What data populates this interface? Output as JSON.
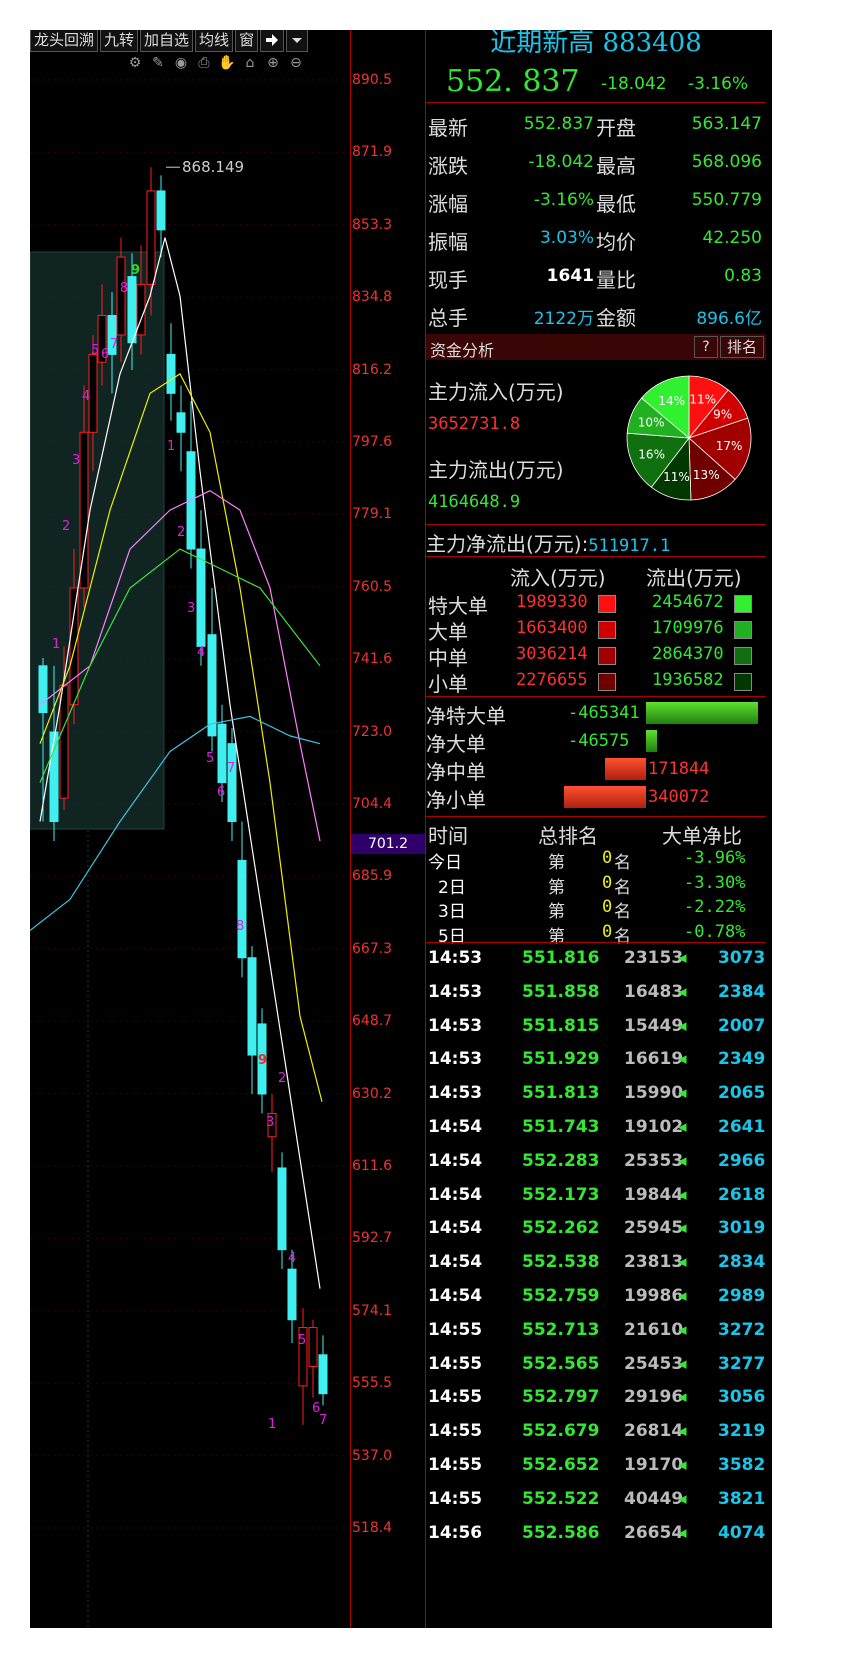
{
  "toolbar": {
    "items": [
      "龙头回溯",
      "九转",
      "加自选",
      "均线",
      "窗"
    ],
    "arrow_icon": "exit-arrow-icon",
    "dropdown_icon": "chevron-down-icon"
  },
  "chart_icons": [
    "settings-icon",
    "pencil-icon",
    "eye-icon",
    "printer-icon",
    "hand-icon",
    "lock-icon",
    "zoom-in-icon",
    "zoom-out-icon"
  ],
  "chart": {
    "y_ticks": [
      "890.5",
      "871.9",
      "853.3",
      "834.8",
      "816.2",
      "797.6",
      "779.1",
      "760.5",
      "741.6",
      "723.0",
      "704.4",
      "685.9",
      "667.3",
      "648.7",
      "630.2",
      "611.6",
      "592.7",
      "574.1",
      "555.5",
      "537.0",
      "518.4"
    ],
    "current_price_marker": "701.2",
    "high_annotation": "868.149",
    "nine_turn_labels_up": [
      "1",
      "2",
      "3",
      "4",
      "5",
      "6",
      "7",
      "8",
      "9"
    ],
    "nine_turn_labels_down": [
      "1",
      "2",
      "3",
      "4",
      "5",
      "6",
      "7",
      "8",
      "9",
      "1",
      "2",
      "3",
      "4",
      "5",
      "6",
      "7"
    ],
    "colors": {
      "up": "#ff2020",
      "down": "#40f0f0",
      "ma5": "#ffffff",
      "ma10": "#f0f000",
      "ma20": "#ff80ff",
      "ma30": "#40e040",
      "ma60": "#40c0e0"
    }
  },
  "panel": {
    "title": "近期新高 883408",
    "price": "552. 837",
    "change": "-18.042",
    "change_pct": "-3.16%",
    "quote_rows": [
      {
        "l1": "最新",
        "v1": "552.837",
        "l2": "开盘",
        "v2": "563.147"
      },
      {
        "l1": "涨跌",
        "v1": "-18.042",
        "l2": "最高",
        "v2": "568.096"
      },
      {
        "l1": "涨幅",
        "v1": "-3.16%",
        "l2": "最低",
        "v2": "550.779"
      },
      {
        "l1": "振幅",
        "v1": "3.03%",
        "l2": "均价",
        "v2": "42.250"
      },
      {
        "l1": "现手",
        "v1": "1641",
        "l2": "量比",
        "v2": "0.83"
      },
      {
        "l1": "总手",
        "v1": "2122万",
        "l2": "金额",
        "v2": "896.6亿"
      }
    ],
    "fund": {
      "title": "资金分析",
      "help": "?",
      "rank": "排名",
      "inflow_label": "主力流入(万元)",
      "inflow_value": "3652731.8",
      "outflow_label": "主力流出(万元)",
      "outflow_value": "4164648.9",
      "net_label": "主力净流出(万元):",
      "net_value": "511917.1",
      "pie": [
        {
          "pct": "11%",
          "value": 11,
          "color": "#ff1010"
        },
        {
          "pct": "9%",
          "value": 9,
          "color": "#d00000"
        },
        {
          "pct": "17%",
          "value": 17,
          "color": "#a00000"
        },
        {
          "pct": "13%",
          "value": 13,
          "color": "#700000"
        },
        {
          "pct": "11%",
          "value": 11,
          "color": "#003800"
        },
        {
          "pct": "16%",
          "value": 16,
          "color": "#107010"
        },
        {
          "pct": "10%",
          "value": 10,
          "color": "#20b020"
        },
        {
          "pct": "14%",
          "value": 14,
          "color": "#30f030"
        }
      ],
      "table_hdr_in": "流入(万元)",
      "table_hdr_out": "流出(万元)",
      "orders": [
        {
          "label": "特大单",
          "in": "1989330",
          "out": "2454672",
          "cin": "#ff1010",
          "cout": "#30f030"
        },
        {
          "label": "大单",
          "in": "1663400",
          "out": "1709976",
          "cin": "#d00000",
          "cout": "#20b020"
        },
        {
          "label": "中单",
          "in": "3036214",
          "out": "2864370",
          "cin": "#a00000",
          "cout": "#107010"
        },
        {
          "label": "小单",
          "in": "2276655",
          "out": "1936582",
          "cin": "#700000",
          "cout": "#003800"
        }
      ],
      "net": [
        {
          "label": "净特大单",
          "value": "-465341",
          "side": "neg",
          "level": 1.0
        },
        {
          "label": "净大单",
          "value": "-46575",
          "side": "neg",
          "level": 0.1
        },
        {
          "label": "净中单",
          "value": "171844",
          "side": "pos",
          "level": 0.37
        },
        {
          "label": "净小单",
          "value": "340072",
          "side": "pos",
          "level": 0.73
        }
      ]
    },
    "ranking": {
      "hdr_time": "时间",
      "hdr_rank": "总排名",
      "hdr_ratio": "大单净比",
      "rows": [
        {
          "t": "今日",
          "di": "第",
          "n": "0",
          "ming": "名",
          "r": "-3.96%"
        },
        {
          "t": "2日",
          "di": "第",
          "n": "0",
          "ming": "名",
          "r": "-3.30%"
        },
        {
          "t": "3日",
          "di": "第",
          "n": "0",
          "ming": "名",
          "r": "-2.22%"
        },
        {
          "t": "5日",
          "di": "第",
          "n": "0",
          "ming": "名",
          "r": "-0.78%"
        }
      ]
    },
    "ticks": [
      {
        "t": "14:53",
        "p": "551.816",
        "v": "23153",
        "n": "3073"
      },
      {
        "t": "14:53",
        "p": "551.858",
        "v": "16483",
        "n": "2384"
      },
      {
        "t": "14:53",
        "p": "551.815",
        "v": "15449",
        "n": "2007"
      },
      {
        "t": "14:53",
        "p": "551.929",
        "v": "16619",
        "n": "2349"
      },
      {
        "t": "14:53",
        "p": "551.813",
        "v": "15990",
        "n": "2065"
      },
      {
        "t": "14:54",
        "p": "551.743",
        "v": "19102",
        "n": "2641"
      },
      {
        "t": "14:54",
        "p": "552.283",
        "v": "25353",
        "n": "2966"
      },
      {
        "t": "14:54",
        "p": "552.173",
        "v": "19844",
        "n": "2618"
      },
      {
        "t": "14:54",
        "p": "552.262",
        "v": "25945",
        "n": "3019"
      },
      {
        "t": "14:54",
        "p": "552.538",
        "v": "23813",
        "n": "2834"
      },
      {
        "t": "14:54",
        "p": "552.759",
        "v": "19986",
        "n": "2989"
      },
      {
        "t": "14:55",
        "p": "552.713",
        "v": "21610",
        "n": "3272"
      },
      {
        "t": "14:55",
        "p": "552.565",
        "v": "25453",
        "n": "3277"
      },
      {
        "t": "14:55",
        "p": "552.797",
        "v": "29196",
        "n": "3056"
      },
      {
        "t": "14:55",
        "p": "552.679",
        "v": "26814",
        "n": "3219"
      },
      {
        "t": "14:55",
        "p": "552.652",
        "v": "19170",
        "n": "3582"
      },
      {
        "t": "14:55",
        "p": "552.522",
        "v": "40449",
        "n": "3821"
      },
      {
        "t": "14:56",
        "p": "552.586",
        "v": "26654",
        "n": "4074"
      }
    ],
    "tick_arrow": "sell-arrow-icon"
  }
}
